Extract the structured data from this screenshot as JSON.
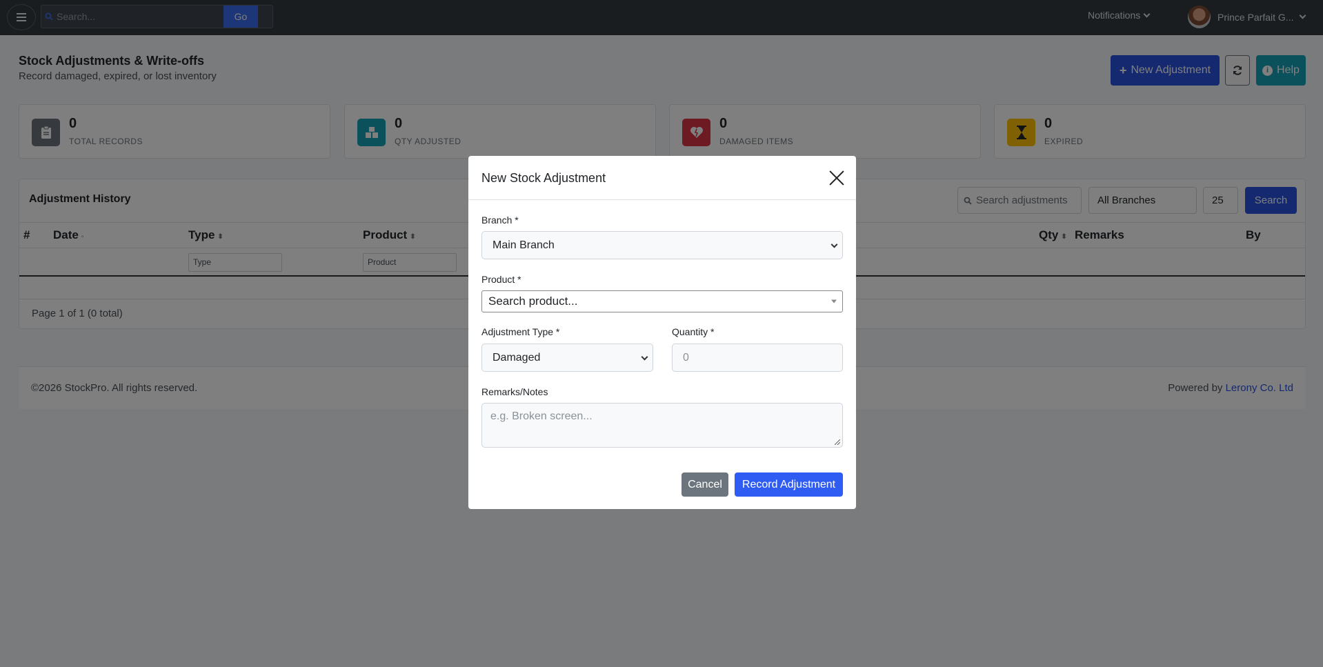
{
  "topbar": {
    "search_placeholder": "Search...",
    "go_label": "Go",
    "notifications_label": "Notifications",
    "user_name": "Prince Parfait G..."
  },
  "page": {
    "title": "Stock Adjustments & Write-offs",
    "subtitle": "Record damaged, expired, or lost inventory",
    "new_button": "New Adjustment",
    "help_button": "Help"
  },
  "stats": [
    {
      "value": "0",
      "label": "TOTAL RECORDS",
      "icon": "clipboard-icon",
      "color": "#6c757d"
    },
    {
      "value": "0",
      "label": "QTY ADJUSTED",
      "icon": "boxes-icon",
      "color": "#17a2b8"
    },
    {
      "value": "0",
      "label": "DAMAGED ITEMS",
      "icon": "heart-broken-icon",
      "color": "#dc3545"
    },
    {
      "value": "0",
      "label": "EXPIRED",
      "icon": "hourglass-icon",
      "color": "#ffc107"
    }
  ],
  "history": {
    "title": "Adjustment History",
    "search_placeholder": "Search adjustments",
    "branch_filter": "All Branches",
    "page_size": "25",
    "search_button": "Search",
    "columns": {
      "num": "#",
      "date": "Date",
      "type": "Type",
      "product": "Product",
      "qty": "Qty",
      "remarks": "Remarks",
      "by": "By"
    },
    "filter_type": "Type",
    "filter_product": "Product",
    "page_info": "Page 1 of 1 (0 total)"
  },
  "footer": {
    "copyright": "©2026 StockPro. All rights reserved.",
    "powered_prefix": "Powered by",
    "powered_link": "Lerony Co. Ltd"
  },
  "modal": {
    "title": "New Stock Adjustment",
    "branch_label": "Branch *",
    "branch_value": "Main Branch",
    "product_label": "Product *",
    "product_placeholder": "Search product...",
    "type_label": "Adjustment Type *",
    "type_value": "Damaged",
    "qty_label": "Quantity *",
    "qty_placeholder": "0",
    "remarks_label": "Remarks/Notes",
    "remarks_placeholder": "e.g. Broken screen...",
    "cancel_button": "Cancel",
    "submit_button": "Record Adjustment"
  },
  "colors": {
    "primary": "#2853e0",
    "info": "#17a2b8",
    "secondary": "#6c757d",
    "topbar": "#343a40"
  }
}
